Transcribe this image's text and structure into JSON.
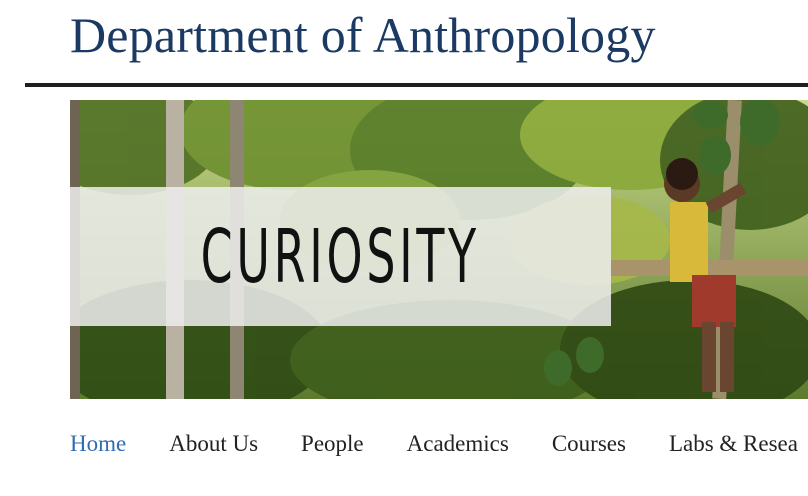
{
  "header": {
    "site_title": "Department of Anthropology"
  },
  "hero": {
    "word": "Curiosity",
    "image_description": "forest-with-child-climbing-papaya-tree"
  },
  "nav": {
    "items": [
      {
        "label": "Home",
        "active": true
      },
      {
        "label": "About Us",
        "active": false
      },
      {
        "label": "People",
        "active": false
      },
      {
        "label": "Academics",
        "active": false
      },
      {
        "label": "Courses",
        "active": false
      },
      {
        "label": "Labs & Resea",
        "active": false
      }
    ]
  },
  "colors": {
    "title": "#1b3a63",
    "nav_active": "#2d6db3",
    "nav_text": "#222222",
    "rule": "#1f1f1f"
  }
}
